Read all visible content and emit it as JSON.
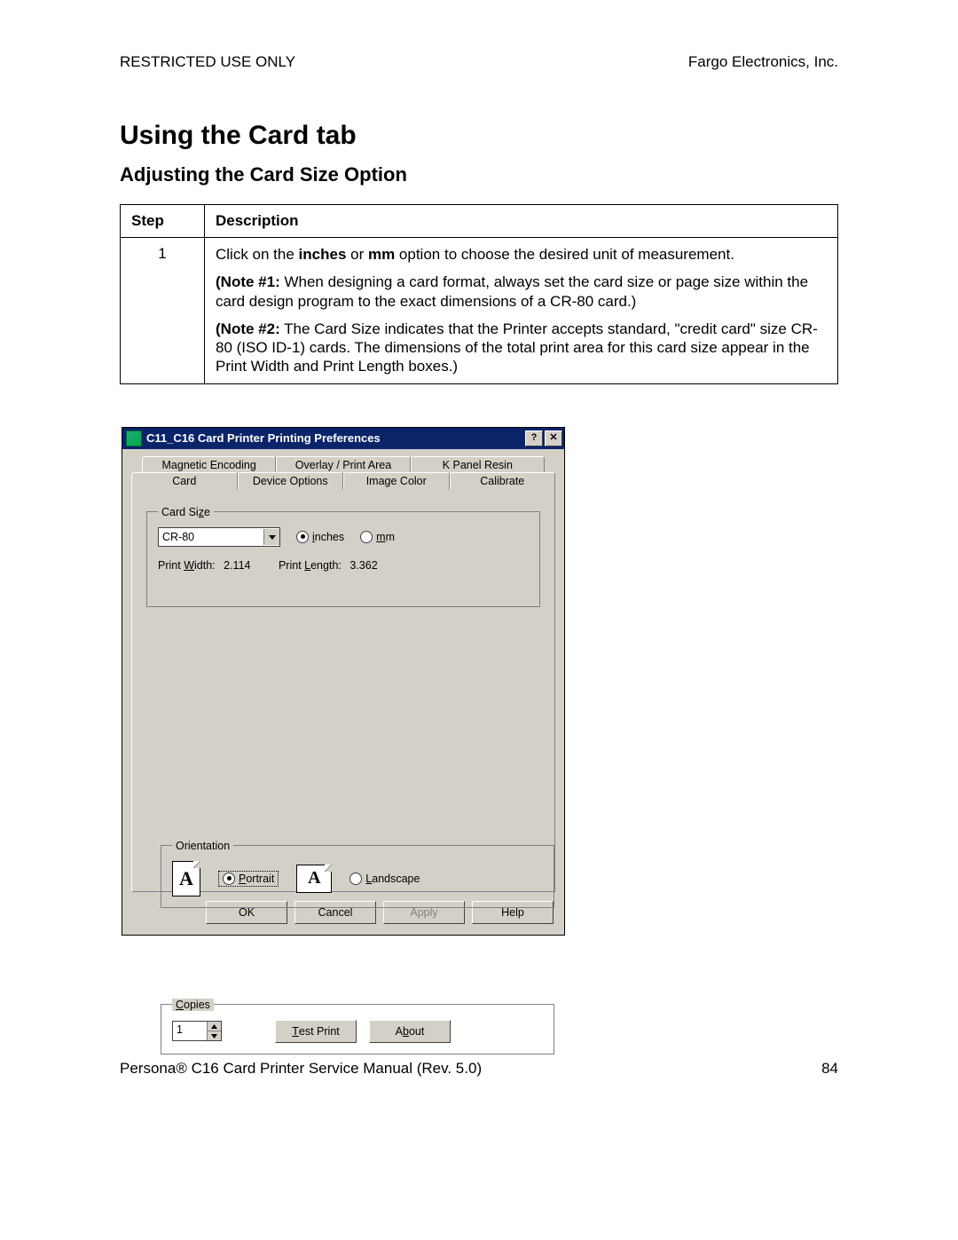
{
  "header": {
    "left": "RESTRICTED USE ONLY",
    "right": "Fargo Electronics, Inc."
  },
  "titles": {
    "h1": "Using the Card tab",
    "h2": "Adjusting the Card Size Option"
  },
  "table": {
    "headers": {
      "step": "Step",
      "desc": "Description"
    },
    "row": {
      "step": "1",
      "p1_a": "Click on the ",
      "p1_b": "inches",
      "p1_c": " or ",
      "p1_d": "mm",
      "p1_e": " option to choose the desired unit of measurement.",
      "p2_a": "(Note #1:",
      "p2_b": "  When designing a card format, always set the card size or page size within the card design program to the exact dimensions of a CR-80 card.)",
      "p3_a": "(Note #2:",
      "p3_b": "  The Card Size indicates that the Printer accepts standard, \"credit card\" size CR-80 (ISO ID-1) cards. The dimensions of the total print area for this card size appear in the Print Width and Print Length boxes.)"
    }
  },
  "dialog": {
    "title": "C11_C16 Card Printer Printing Preferences",
    "help_btn": "?",
    "close_btn": "✕",
    "tabs_back": [
      "Magnetic Encoding",
      "Overlay / Print Area",
      "K Panel Resin"
    ],
    "tabs_front": [
      "Card",
      "Device Options",
      "Image Color",
      "Calibrate"
    ],
    "card_size": {
      "legend_pre": "Card Si",
      "legend_u": "z",
      "legend_post": "e",
      "combo_value": "CR-80",
      "radio_inches_u": "i",
      "radio_inches_post": "nches",
      "radio_mm_u": "m",
      "radio_mm_post": "m",
      "pw_lbl_pre": "Print ",
      "pw_lbl_u": "W",
      "pw_lbl_post": "idth:",
      "pw_val": "2.114",
      "pl_lbl_pre": "Print ",
      "pl_lbl_u": "L",
      "pl_lbl_post": "ength:",
      "pl_val": "3.362"
    },
    "orientation": {
      "legend": "Orientation",
      "portrait_u": "P",
      "portrait_post": "ortrait",
      "landscape_u": "L",
      "landscape_post": "andscape",
      "glyph": "A"
    },
    "copies": {
      "legend_u": "C",
      "legend_post": "opies",
      "value": "1",
      "test_u": "T",
      "test_post": "est Print",
      "about_pre": "A",
      "about_u": "b",
      "about_post": "out"
    },
    "buttons": {
      "ok": "OK",
      "cancel": "Cancel",
      "apply": "Apply",
      "help": "Help"
    }
  },
  "footer": {
    "left": "Persona® C16 Card Printer Service Manual (Rev. 5.0)",
    "right": "84"
  }
}
